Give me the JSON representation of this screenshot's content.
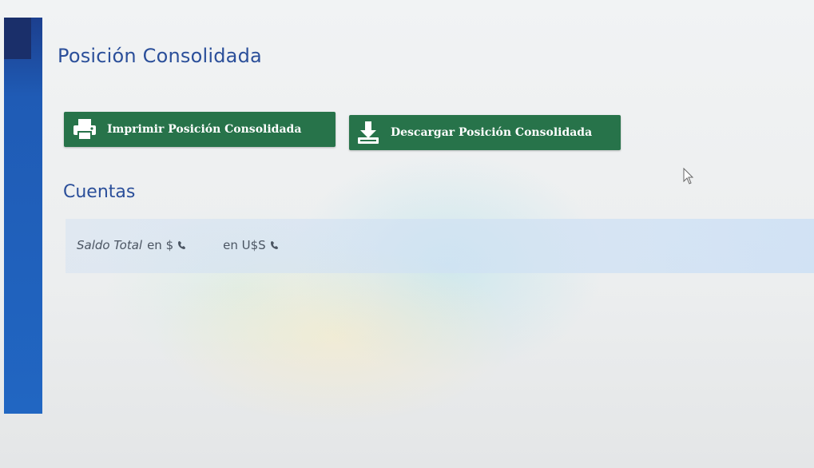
{
  "page": {
    "title": "Posición Consolidada"
  },
  "toolbar": {
    "print_label": "Imprimir Posición Consolidada",
    "print_icon": "printer-icon",
    "download_label": "Descargar Posición Consolidada",
    "download_icon": "download-icon",
    "button_color": "#27734a"
  },
  "accounts": {
    "title": "Cuentas",
    "balance_label": "Saldo Total",
    "pesos_label": "en $",
    "dollars_label": "en U$S",
    "loading_icon": "spinner-icon"
  },
  "colors": {
    "accent": "#2b4f9a",
    "sidebar": "#2166c2"
  }
}
